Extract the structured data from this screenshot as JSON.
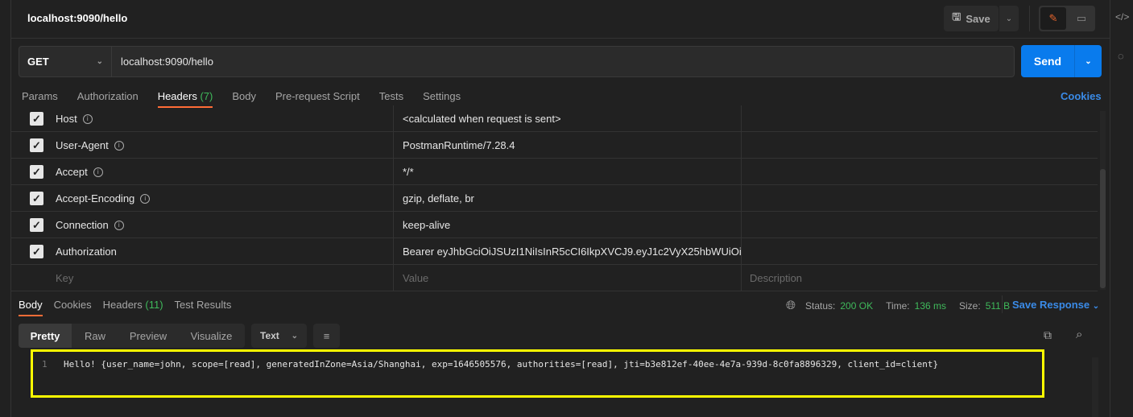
{
  "request": {
    "title": "localhost:9090/hello",
    "method": "GET",
    "url": "localhost:9090/hello",
    "save_label": "Save",
    "send_label": "Send"
  },
  "tabs": [
    {
      "label": "Params"
    },
    {
      "label": "Authorization"
    },
    {
      "label": "Headers",
      "count": "(7)",
      "active": true
    },
    {
      "label": "Body"
    },
    {
      "label": "Pre-request Script"
    },
    {
      "label": "Tests"
    },
    {
      "label": "Settings"
    }
  ],
  "cookies_label": "Cookies",
  "headers": [
    {
      "key": "Host",
      "value": "<calculated when request is sent>",
      "checked": true,
      "info": true
    },
    {
      "key": "User-Agent",
      "value": "PostmanRuntime/7.28.4",
      "checked": true,
      "info": true
    },
    {
      "key": "Accept",
      "value": "*/*",
      "checked": true,
      "info": true
    },
    {
      "key": "Accept-Encoding",
      "value": "gzip, deflate, br",
      "checked": true,
      "info": true
    },
    {
      "key": "Connection",
      "value": "keep-alive",
      "checked": true,
      "info": true
    },
    {
      "key": "Authorization",
      "value": "Bearer eyJhbGciOiJSUzI1NiIsInR5cCI6IkpXVCJ9.eyJ1c2VyX25hbWUiOiJ...",
      "checked": true,
      "info": false
    }
  ],
  "placeholders": {
    "key": "Key",
    "value": "Value",
    "description": "Description"
  },
  "response": {
    "tabs": [
      {
        "label": "Body",
        "active": true
      },
      {
        "label": "Cookies"
      },
      {
        "label": "Headers",
        "count": "(11)"
      },
      {
        "label": "Test Results"
      }
    ],
    "status_label": "Status:",
    "status": "200 OK",
    "time_label": "Time:",
    "time": "136 ms",
    "size_label": "Size:",
    "size": "511 B",
    "save_response": "Save Response",
    "views": [
      "Pretty",
      "Raw",
      "Preview",
      "Visualize"
    ],
    "format": "Text",
    "line_number": "1",
    "body": "Hello! {user_name=john, scope=[read], generatedInZone=Asia/Shanghai, exp=1646505576, authorities=[read], jti=b3e812ef-40ee-4e7a-939d-8c0fa8896329, client_id=client}"
  },
  "colors": {
    "accent": "#ff6c37",
    "send": "#097bed",
    "link": "#3a8be8",
    "success": "#3fb95b",
    "highlight": "#ffff00"
  }
}
